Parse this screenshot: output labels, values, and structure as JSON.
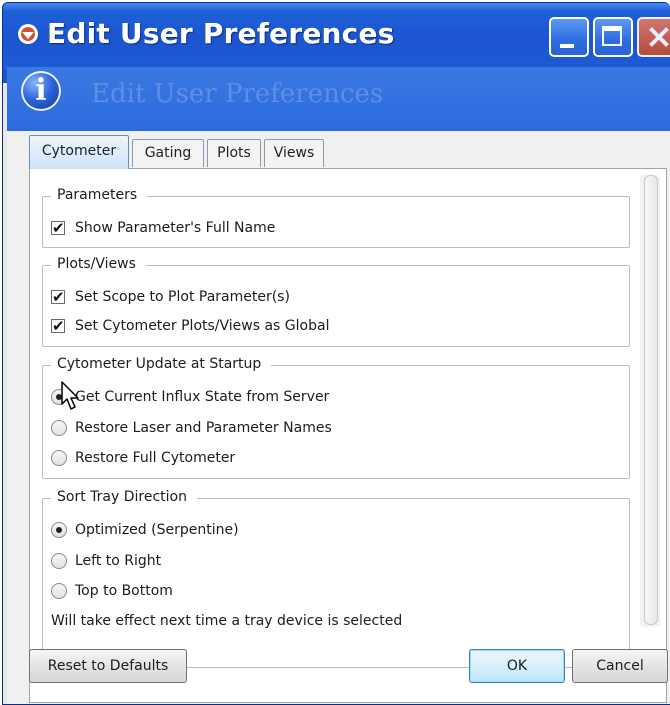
{
  "window": {
    "title": "Edit User Preferences",
    "header_title": "Edit User Preferences"
  },
  "tabs": [
    {
      "label": "Cytometer",
      "active": true
    },
    {
      "label": "Gating",
      "active": false
    },
    {
      "label": "Plots",
      "active": false
    },
    {
      "label": "Views",
      "active": false
    }
  ],
  "groups": {
    "parameters": {
      "legend": "Parameters",
      "show_full_name": {
        "label": "Show Parameter's Full Name",
        "checked": true
      }
    },
    "plots_views": {
      "legend": "Plots/Views",
      "scope": {
        "label": "Set Scope to Plot Parameter(s)",
        "checked": true
      },
      "global": {
        "label": "Set Cytometer Plots/Views as Global",
        "checked": true
      }
    },
    "startup": {
      "legend": "Cytometer Update at Startup",
      "options": [
        {
          "label": "Get Current Influx State from Server",
          "selected": true
        },
        {
          "label": "Restore Laser and Parameter Names",
          "selected": false
        },
        {
          "label": "Restore Full Cytometer",
          "selected": false
        }
      ]
    },
    "sort_tray": {
      "legend": "Sort Tray Direction",
      "options": [
        {
          "label": "Optimized (Serpentine)",
          "selected": true
        },
        {
          "label": "Left to Right",
          "selected": false
        },
        {
          "label": "Top to Bottom",
          "selected": false
        }
      ],
      "note": "Will take effect next time a tray device is selected"
    }
  },
  "buttons": {
    "reset": "Reset to Defaults",
    "ok": "OK",
    "cancel": "Cancel"
  },
  "colors": {
    "titlebar": "#1f5fd8",
    "header_band": "#2c6bde",
    "ok_button": "#bee6fd"
  },
  "icons": [
    "app-icon",
    "minimize-icon",
    "maximize-icon",
    "close-icon",
    "info-icon",
    "mouse-cursor-icon"
  ]
}
